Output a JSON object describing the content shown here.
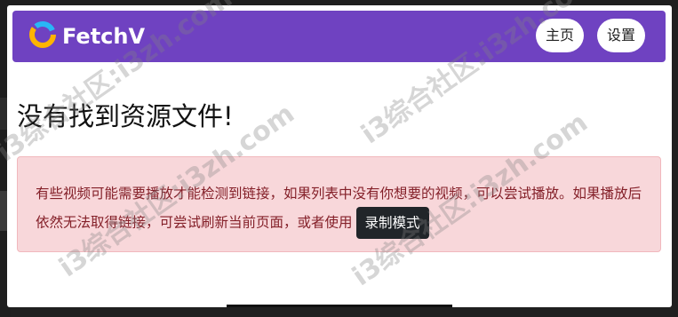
{
  "brand": {
    "name": "FetchV"
  },
  "nav": {
    "home": "主页",
    "settings": "设置"
  },
  "main": {
    "title": "没有找到资源文件!",
    "alert_text": "有些视频可能需要播放才能检测到链接，如果列表中没有你想要的视频，可以尝试播放。如果播放后依然无法取得链接，可尝试刷新当前页面，或者使用",
    "record_button": "录制模式"
  },
  "watermark": {
    "text": "i3综合社区:i3zh.com"
  },
  "colors": {
    "navbar": "#6f42c1",
    "alert_bg": "#f8d7da",
    "alert_text": "#842029",
    "record_button": "#212529"
  }
}
